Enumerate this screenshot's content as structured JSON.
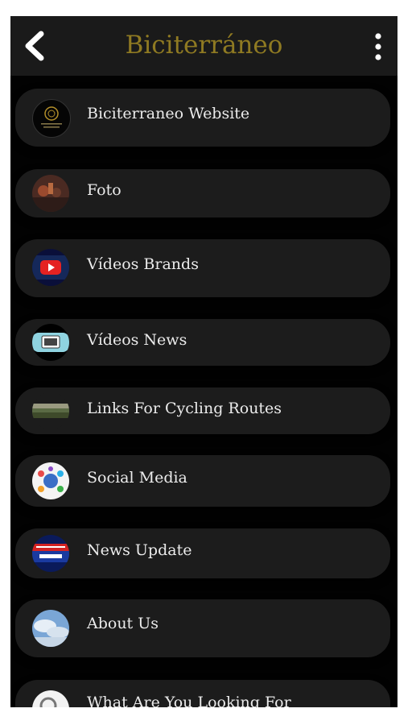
{
  "app": {
    "title": "Biciterráneo",
    "title_color": "#8f7a22"
  },
  "icons": {
    "back": "back-arrow-icon",
    "menu": "more-vert-icon"
  },
  "menu_items": [
    {
      "label": "Biciterraneo Website",
      "icon": "website-logo-icon"
    },
    {
      "label": "Foto",
      "icon": "photo-icon"
    },
    {
      "label": "Vídeos Brands",
      "icon": "youtube-icon"
    },
    {
      "label": "Vídeos News",
      "icon": "video-news-icon"
    },
    {
      "label": "Links For Cycling Routes",
      "icon": "cycling-routes-icon"
    },
    {
      "label": "Social Media",
      "icon": "social-media-icon"
    },
    {
      "label": "News Update",
      "icon": "breaking-news-icon"
    },
    {
      "label": "About Us",
      "icon": "about-us-icon"
    },
    {
      "label": "What Are You Looking For",
      "icon": "search-icon"
    }
  ]
}
